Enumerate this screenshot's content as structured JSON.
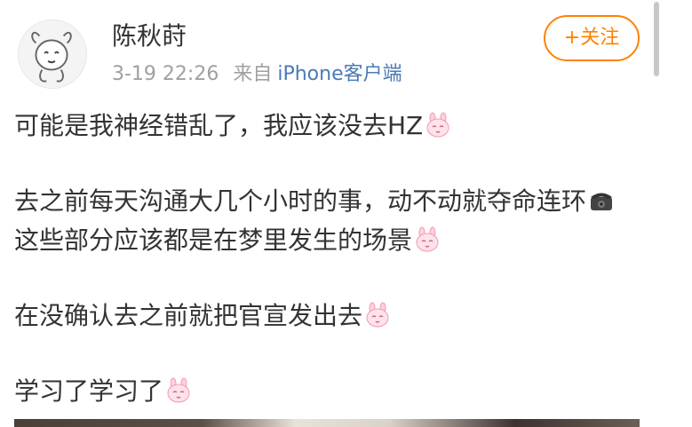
{
  "post": {
    "username": "陈秋莳",
    "timestamp": "3-19 22:26",
    "source_prefix": "来自",
    "source_app": "iPhone客户端",
    "follow_label": "+关注",
    "paragraphs": [
      {
        "text1": "可能是我神经错乱了，我应该没去HZ"
      },
      {
        "text1": "去之前每天沟通大几个小时的事，动不动就夺命连环",
        "text2": "这些部分应该都是在梦里发生的场景"
      },
      {
        "text1": "在没确认去之前就把官宣发出去"
      },
      {
        "text1": "学习了学习了"
      }
    ]
  },
  "icons": {
    "avatar": "cartoon-avatar",
    "emoji": "pink-bunny-emoji",
    "phone": "telephone-emoji"
  },
  "colors": {
    "accent": "#ff8200",
    "link": "#4a7ab7",
    "meta": "#a0a0a0",
    "text": "#333333"
  }
}
